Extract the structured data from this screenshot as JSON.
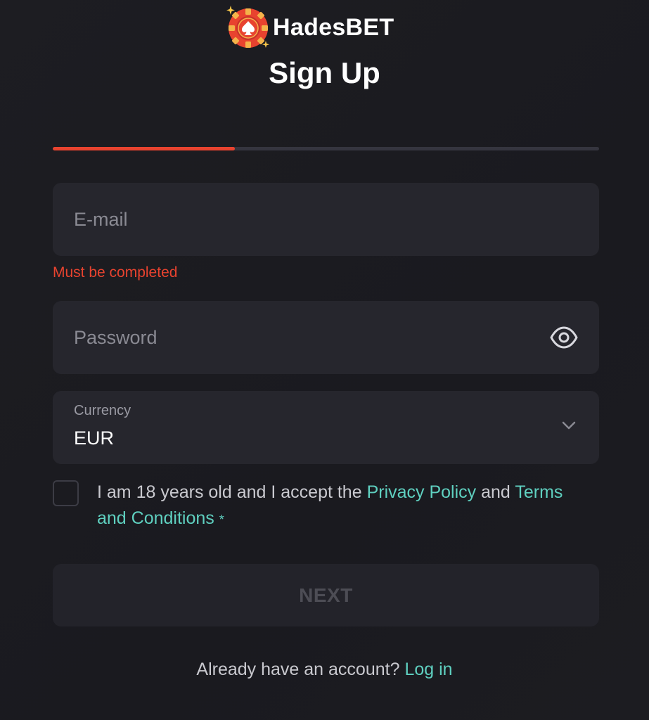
{
  "brand": {
    "name": "HadesBET",
    "accent_color": "#e8432f",
    "link_color": "#5fd0c0"
  },
  "page": {
    "title": "Sign Up"
  },
  "progress": {
    "fraction": 0.333
  },
  "email": {
    "placeholder": "E-mail",
    "value": "",
    "error": "Must be completed"
  },
  "password": {
    "placeholder": "Password",
    "value": "",
    "toggle_icon": "eye-icon"
  },
  "currency": {
    "label": "Currency",
    "value": "EUR",
    "icon": "chevron-down-icon"
  },
  "consent": {
    "checked": false,
    "text_before": "I am 18 years old and I accept the",
    "privacy_link": "Privacy Policy",
    "text_middle": "and",
    "terms_link": "Terms and Conditions",
    "required_marker": "*"
  },
  "actions": {
    "next_label": "NEXT"
  },
  "footer": {
    "prompt": "Already have an account?",
    "login_link": "Log in"
  }
}
